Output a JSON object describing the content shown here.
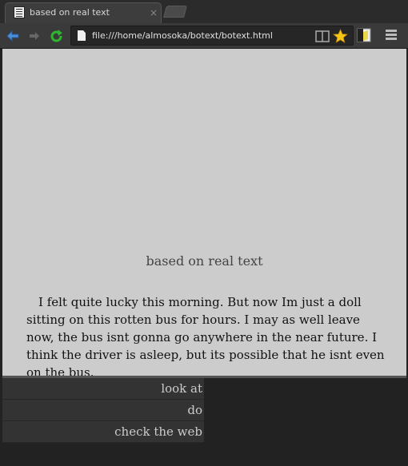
{
  "tab": {
    "title": "based on real text",
    "close": "×"
  },
  "toolbar": {
    "url": "file:///home/almosoka/botext/botext.html"
  },
  "page": {
    "title": "based on real text",
    "story": "I felt quite lucky this morning. But now Im just a doll sitting on this rotten bus for hours. I may as well leave now, the bus isnt gonna go anywhere in the near future. I think the driver is asleep, but its possible that he isnt even on the bus.",
    "actions": [
      "look at",
      "do",
      "check the web"
    ]
  },
  "colors": {
    "page_bg": "#cccccc",
    "action_bg": "#333333",
    "browser_bg": "#3a3a3a"
  },
  "icons": [
    "back-arrow-icon",
    "forward-arrow-icon",
    "reload-icon",
    "page-icon",
    "reader-mode-icon",
    "star-icon",
    "extension-icon",
    "menu-icon"
  ]
}
